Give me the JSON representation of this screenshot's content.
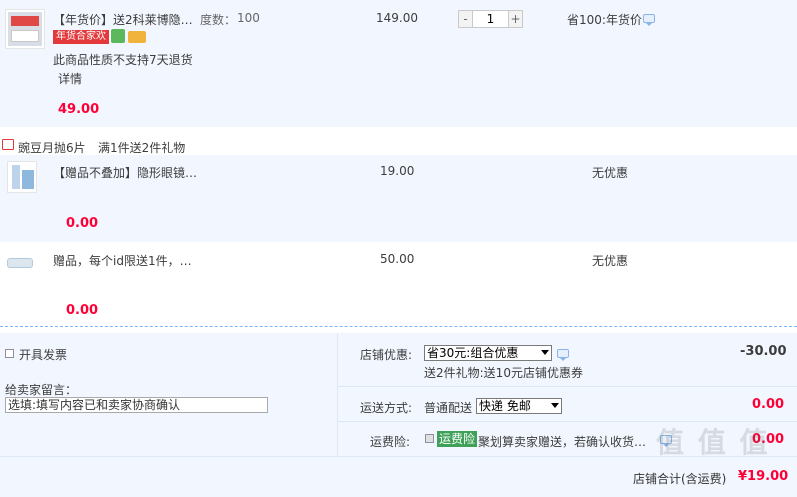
{
  "item1": {
    "title": "【年货价】送2科莱博隐…",
    "spec_label": "度数：",
    "spec_value": "100",
    "badge": "年货合家欢",
    "notice": "此商品性质不支持7天退货",
    "detail_link": "详情",
    "unit_price": "149.00",
    "quantity": "1",
    "minus": "-",
    "plus": "+",
    "discount": "省100:年货价",
    "subtotal": "49.00"
  },
  "gift_group": {
    "name": "豌豆月抛6片",
    "promo": "满1件送2件礼物"
  },
  "item2": {
    "title": "【赠品不叠加】隐形眼镜…",
    "unit_price": "19.00",
    "discount": "无优惠",
    "subtotal": "0.00"
  },
  "item3": {
    "title": "赠品，每个id限送1件，…",
    "unit_price": "50.00",
    "discount": "无优惠",
    "subtotal": "0.00"
  },
  "invoice": {
    "label": "开具发票"
  },
  "message": {
    "label": "给卖家留言：",
    "placeholder": "选填:填写内容已和卖家协商确认"
  },
  "shop_discount": {
    "label": "店铺优惠:",
    "selected": "省30元:组合优惠",
    "detail": "送2件礼物:送10元店铺优惠券",
    "amount": "-30.00"
  },
  "shipping": {
    "label": "运送方式:",
    "method": "普通配送",
    "selected": "快递 免邮",
    "amount": "0.00"
  },
  "insurance": {
    "label": "运费险:",
    "tag": "运费险",
    "text": "聚划算卖家赠送，若确认收货…",
    "amount": "0.00"
  },
  "total": {
    "label": "店铺合计(含运费)",
    "amount": "¥19.00"
  },
  "watermark": "值 值 值",
  "colors": {
    "price_red": "#ff0036",
    "panel_blue": "#f2f7ff",
    "badge_red": "#e4393c",
    "green": "#3fa158"
  }
}
